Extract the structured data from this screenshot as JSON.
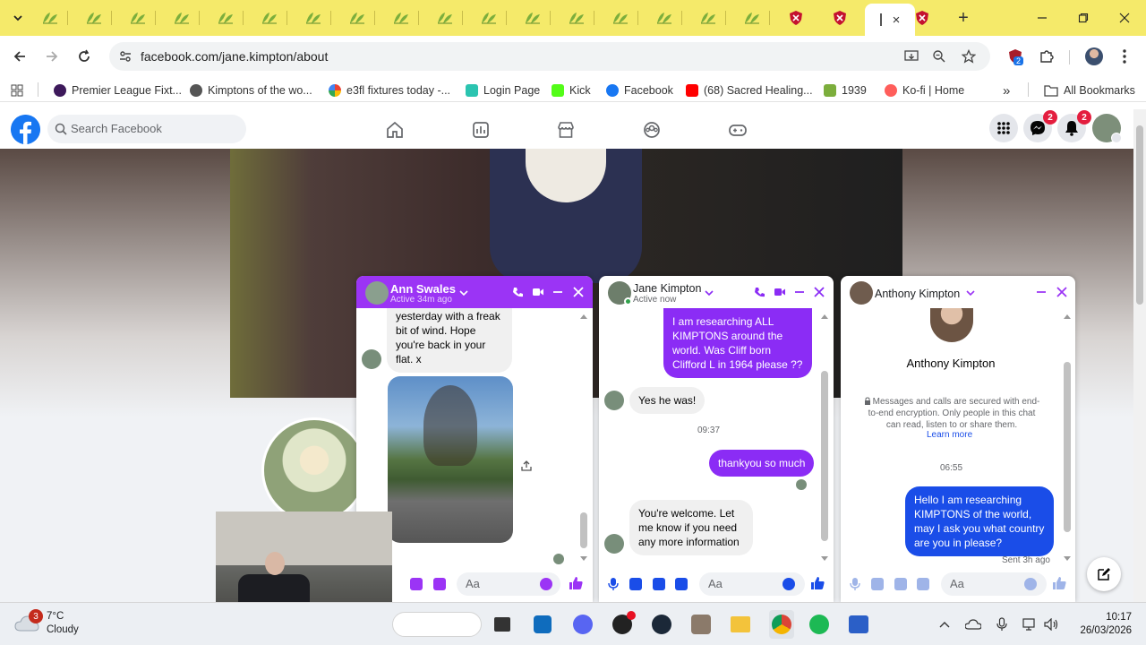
{
  "browser": {
    "tab_count_extensions": 22,
    "active_tab_close": "×",
    "new_tab": "+",
    "url": "facebook.com/jane.kimpton/about",
    "extension_badge": "2",
    "bookmarks": [
      {
        "label": "Premier League Fixt..."
      },
      {
        "label": "Kimptons of the wo..."
      },
      {
        "label": "e3fl fixtures today -..."
      },
      {
        "label": "Login Page"
      },
      {
        "label": "Kick"
      },
      {
        "label": "Facebook"
      },
      {
        "label": "(68) Sacred Healing..."
      },
      {
        "label": "1939"
      },
      {
        "label": "Ko-fi | Home"
      }
    ],
    "more_bookmarks": "»",
    "all_bookmarks": "All Bookmarks"
  },
  "fb": {
    "search_placeholder": "Search Facebook",
    "messenger_badge": "2",
    "notifications_badge": "2"
  },
  "chats": [
    {
      "name": "Ann Swales",
      "status": "Active 34m ago",
      "messages": [
        "yesterday with a freak bit of wind. Hope you're back in your flat. x"
      ],
      "input_placeholder": "Aa"
    },
    {
      "name": "Jane Kimpton",
      "status": "Active now",
      "out_1": "I am researching ALL KIMPTONS around the world.  Was Cliff born Clifford L in 1964 please ??",
      "in_1": "Yes he was!",
      "time_1": "09:37",
      "out_2": "thankyou so much",
      "in_2": "You're welcome. Let me know if you need any more information",
      "input_placeholder": "Aa"
    },
    {
      "name": "Anthony Kimpton",
      "profile_name": "Anthony Kimpton",
      "encryption_text": "Messages and calls are secured with end-to-end encryption. Only people in this chat can read, listen to or share them.",
      "learn_more": "Learn more",
      "time_1": "06:55",
      "out_1": "Hello I am researching KIMPTONS of the world, may I ask you what country are you in please?",
      "sent_status": "Sent 3h ago",
      "input_placeholder": "Aa"
    }
  ],
  "taskbar": {
    "weather_badge": "3",
    "temperature": "7°C",
    "condition": "Cloudy",
    "time": "10:17",
    "date": "26/03/2026"
  },
  "colors": {
    "tab_strip": "#f5ea6a",
    "fb_blue": "#1877f2",
    "ann_header": "#9b34f5",
    "msg_blue": "#1a4de8",
    "msg_purple": "#8b2cf5",
    "notification_red": "#e41e3f"
  }
}
